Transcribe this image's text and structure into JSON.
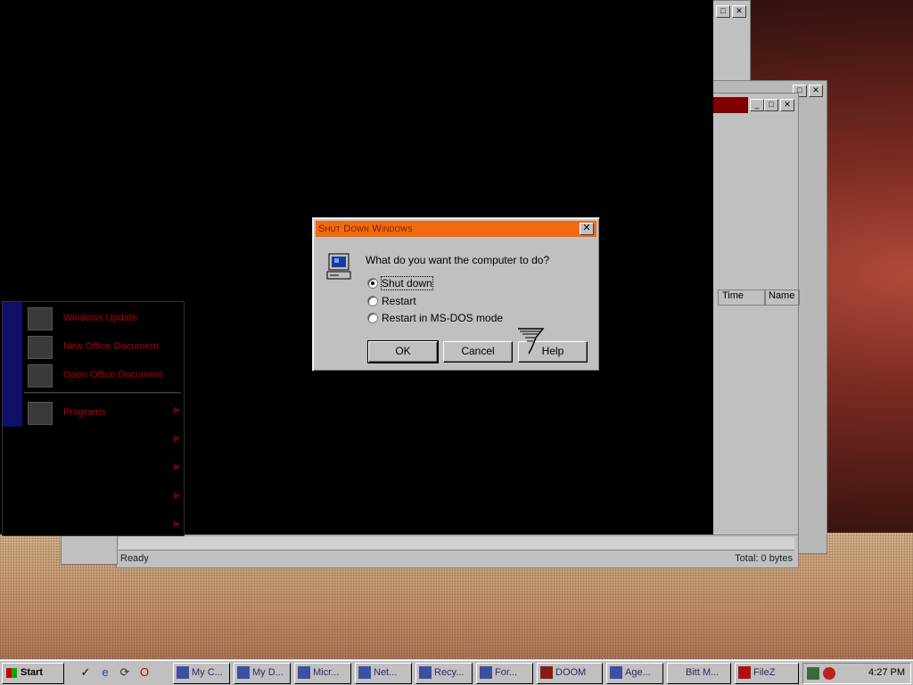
{
  "dialog": {
    "title": "Shut Down Windows",
    "question": "What do you want the computer to do?",
    "options": [
      {
        "label": "Shut down",
        "checked": true
      },
      {
        "label": "Restart",
        "checked": false
      },
      {
        "label": "Restart in MS-DOS mode",
        "checked": false
      }
    ],
    "buttons": {
      "ok": "OK",
      "cancel": "Cancel",
      "help": "Help"
    },
    "close_glyph": "✕",
    "title_color": "#f06a10"
  },
  "start_menu": {
    "items": [
      {
        "label": "Windows Update",
        "icon": "windows-update-icon"
      },
      {
        "label": "New Office Document",
        "icon": "office-document-icon"
      },
      {
        "label": "Open Office Document",
        "icon": "open-folder-icon"
      },
      {
        "label": "Programs",
        "icon": "programs-icon"
      }
    ]
  },
  "background_window": {
    "status_left": "Ready",
    "status_right": "Total: 0 bytes",
    "columns": [
      "Time",
      "Name"
    ]
  },
  "taskbar": {
    "start_label": "Start",
    "tasks": [
      "My C...",
      "My D...",
      "Micr...",
      "Net...",
      "Recy...",
      "For...",
      "DOOM",
      "Age...",
      "Bitt M...",
      "FileZ"
    ],
    "clock": "4:27 PM"
  }
}
